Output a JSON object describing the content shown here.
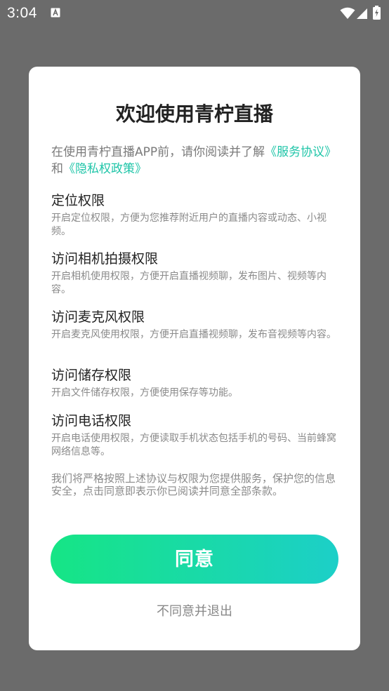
{
  "status_bar": {
    "time": "3:04"
  },
  "dialog": {
    "title": "欢迎使用青柠直播",
    "intro_prefix": "在使用青柠直播APP前，请你阅读并了解",
    "service_link": "《服务协议》",
    "intro_and": "和",
    "privacy_link": "《隐私权政策》",
    "permissions": [
      {
        "title": "定位权限",
        "desc": "开启定位权限，方便为您推荐附近用户的直播内容或动态、小视频。"
      },
      {
        "title": "访问相机拍摄权限",
        "desc": "开启相机使用权限，方便开启直播视频聊，发布图片、视频等内容。"
      },
      {
        "title": "访问麦克风权限",
        "desc": "开启麦克风使用权限，方便开启直播视频聊，发布音视频等内容。"
      },
      {
        "title": "访问储存权限",
        "desc": "开启文件储存权限，方便使用保存等功能。"
      },
      {
        "title": "访问电话权限",
        "desc": "开启电话使用权限，方便读取手机状态包括手机的号码、当前蜂窝网络信息等。"
      }
    ],
    "closing": "我们将严格按照上述协议与权限为您提供服务，保护您的信息安全，点击同意即表示你已阅读并同意全部条款。",
    "agree_label": "同意",
    "disagree_label": "不同意并退出"
  },
  "colors": {
    "link": "#1fc5a8",
    "button_gradient_start": "#16e585",
    "button_gradient_end": "#1ccfc8",
    "overlay": "#6b6b6b"
  }
}
